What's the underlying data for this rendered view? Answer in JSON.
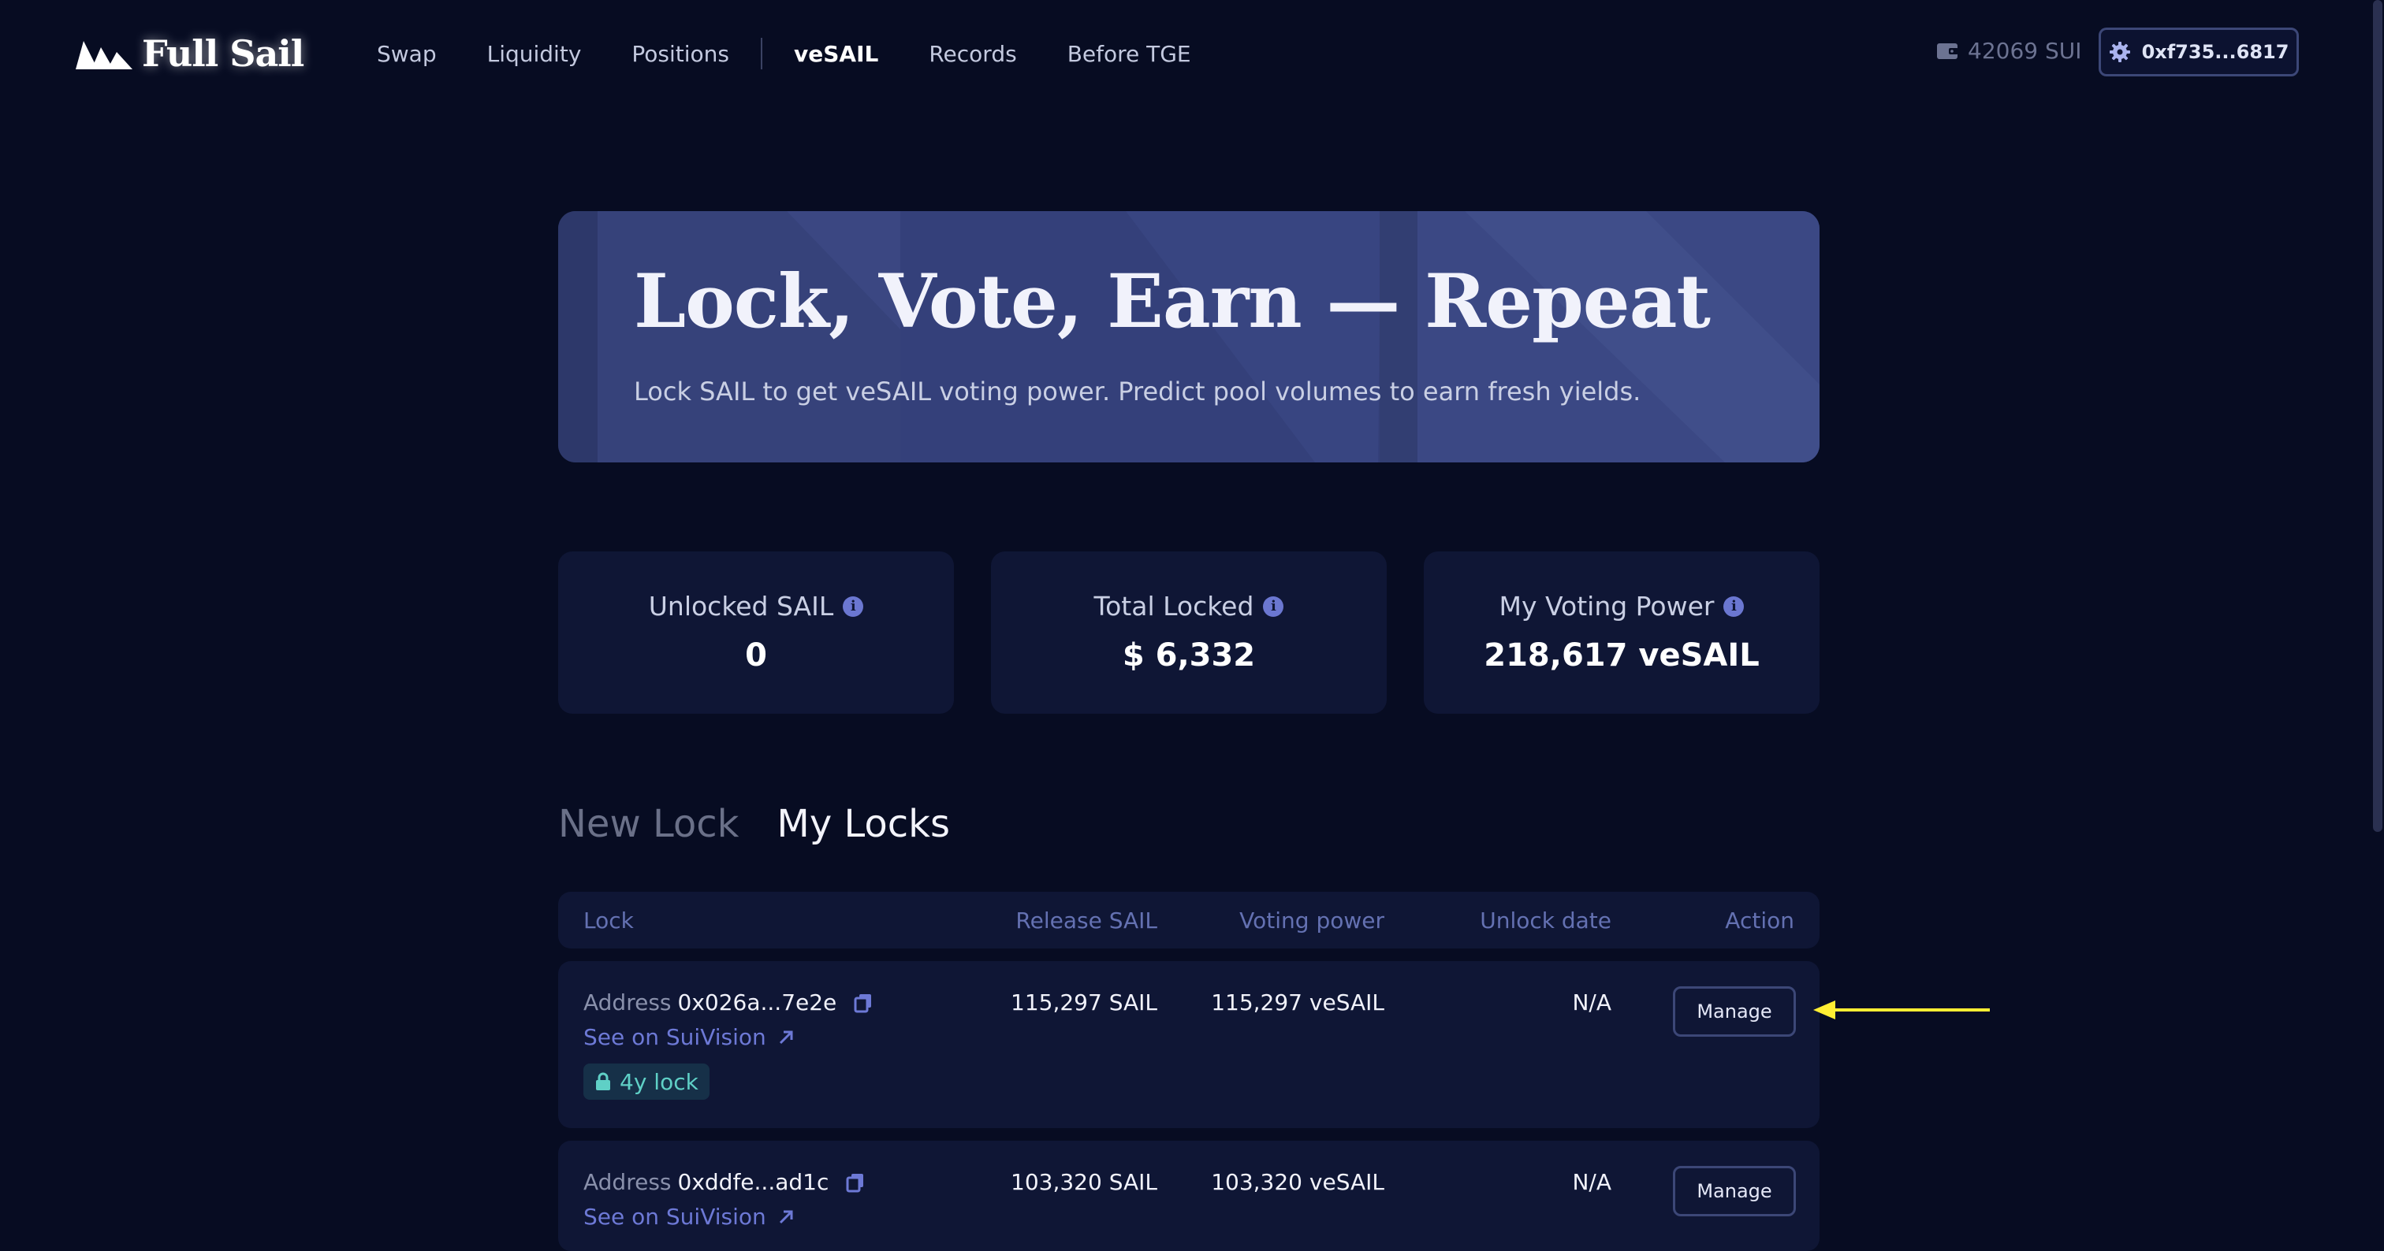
{
  "brand": {
    "name": "Full Sail"
  },
  "nav": {
    "items": [
      "Swap",
      "Liquidity",
      "Positions",
      "veSAIL",
      "Records",
      "Before TGE"
    ],
    "active": "veSAIL"
  },
  "wallet": {
    "balance": "42069 SUI",
    "address": "0xf735...6817"
  },
  "hero": {
    "title": "Lock, Vote, Earn — Repeat",
    "subtitle": "Lock SAIL to get veSAIL voting power. Predict pool volumes to earn fresh yields."
  },
  "stats": [
    {
      "label": "Unlocked SAIL",
      "value": "0"
    },
    {
      "label": "Total Locked",
      "value": "$ 6,332"
    },
    {
      "label": "My Voting Power",
      "value": "218,617 veSAIL"
    }
  ],
  "tabs": {
    "new_lock": "New Lock",
    "my_locks": "My Locks",
    "active": "My Locks"
  },
  "table": {
    "headers": {
      "lock": "Lock",
      "release": "Release SAIL",
      "voting": "Voting power",
      "unlock": "Unlock date",
      "action": "Action"
    },
    "rows": [
      {
        "address_label": "Address",
        "address": "0x026a...7e2e",
        "link": "See on SuiVision",
        "badge": "4y lock",
        "release": "115,297 SAIL",
        "voting": "115,297 veSAIL",
        "unlock": "N/A",
        "action": "Manage"
      },
      {
        "address_label": "Address",
        "address": "0xddfe...ad1c",
        "link": "See on SuiVision",
        "release": "103,320 SAIL",
        "voting": "103,320 veSAIL",
        "unlock": "N/A",
        "action": "Manage"
      }
    ]
  },
  "colors": {
    "background": "#070c22",
    "card": "#0f1635",
    "hero": "#323e72",
    "accent": "#6d79d6",
    "badge_text": "#5fd0c6",
    "annotation_arrow": "#ffee33"
  }
}
